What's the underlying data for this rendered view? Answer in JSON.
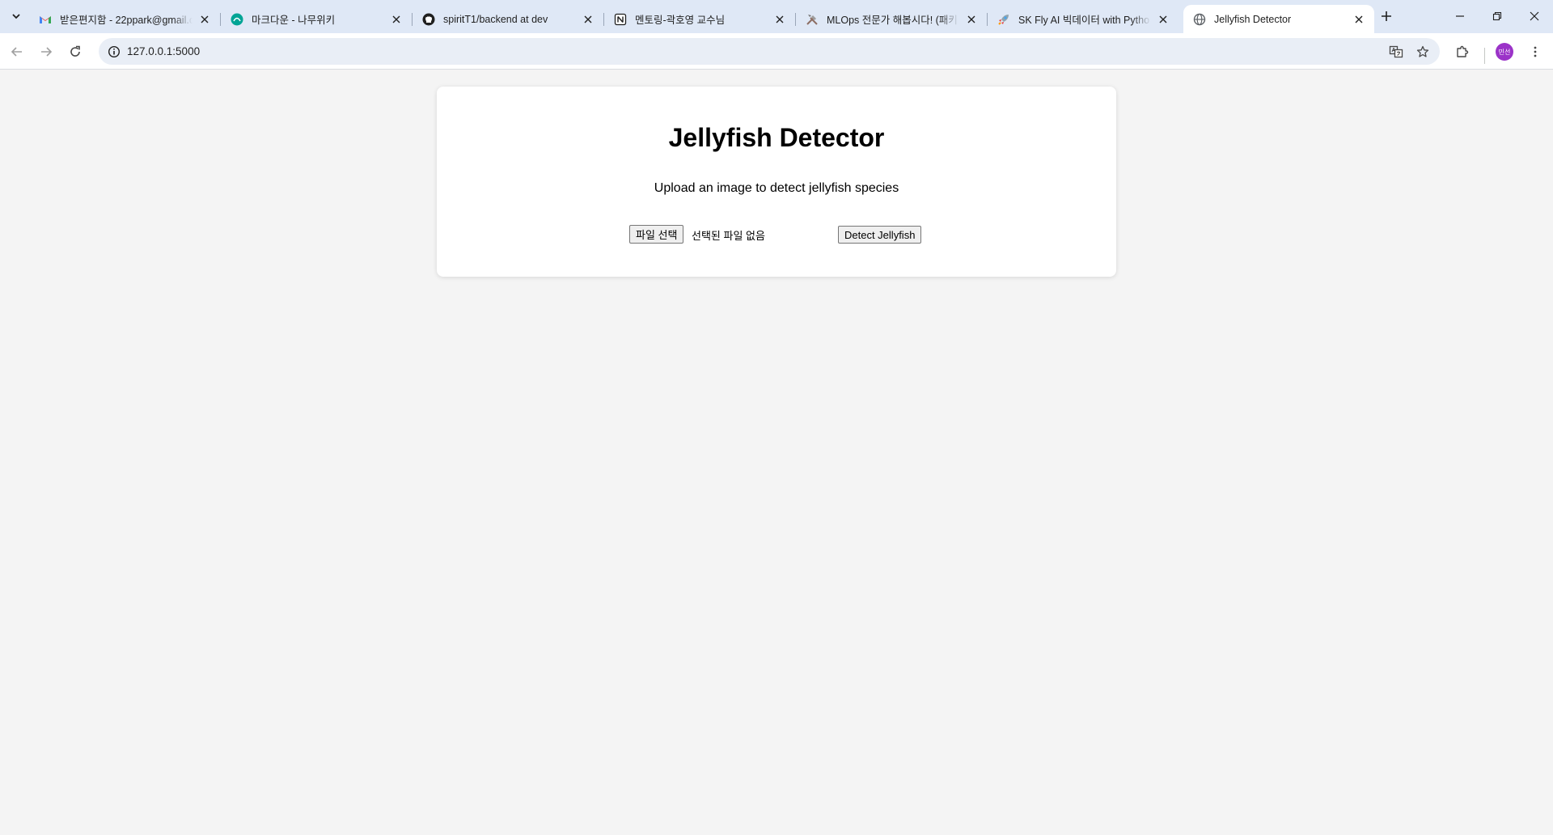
{
  "browser": {
    "tabs": [
      {
        "title": "받은편지함 - 22ppark@gmail.c",
        "favicon": "gmail-icon"
      },
      {
        "title": "마크다운 - 나무위키",
        "favicon": "namuwiki-icon"
      },
      {
        "title": "spiritT1/backend at dev",
        "favicon": "github-icon"
      },
      {
        "title": "멘토링-곽호영 교수님",
        "favicon": "notion-icon"
      },
      {
        "title": "MLOps 전문가 해봅시다! (패키",
        "favicon": "tools-icon"
      },
      {
        "title": "SK Fly AI 빅데이터 with Pytho",
        "favicon": "rocket-icon"
      },
      {
        "title": "Jellyfish Detector",
        "favicon": "globe-icon",
        "active": true
      }
    ],
    "address_bar": {
      "url": "127.0.0.1:5000"
    },
    "profile": {
      "initials": "민선",
      "color": "#9b33c8"
    },
    "accent_color": "#dfe8f6"
  },
  "page": {
    "title": "Jellyfish Detector",
    "subtitle": "Upload an image to detect jellyfish species",
    "file_input": {
      "button_label": "파일 선택",
      "status": "선택된 파일 없음"
    },
    "submit_label": "Detect Jellyfish"
  }
}
